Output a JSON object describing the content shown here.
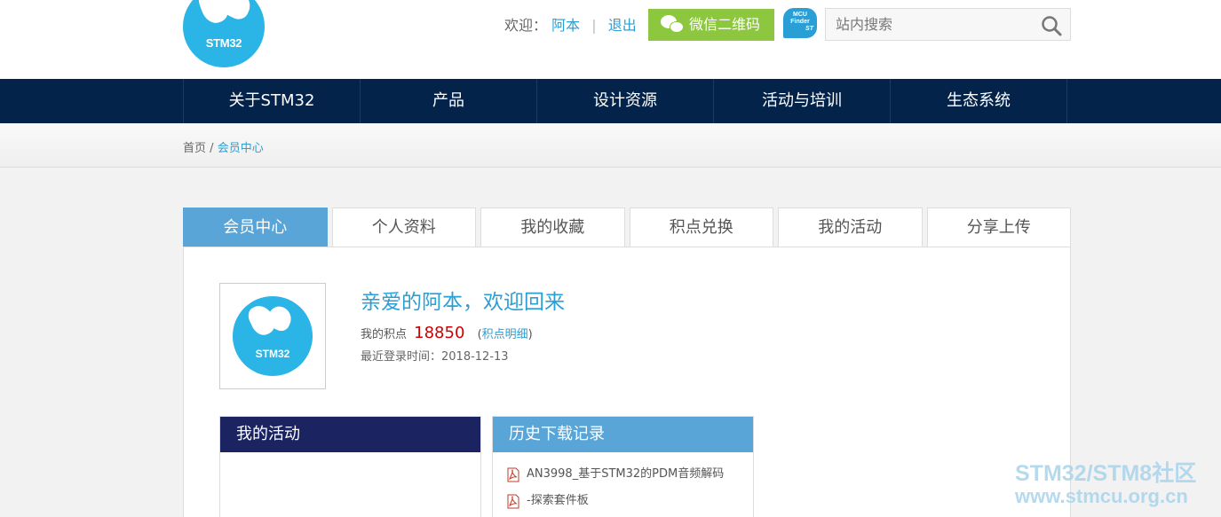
{
  "header": {
    "logo_text": "STM32",
    "welcome_label": "欢迎：",
    "username": "阿本",
    "separator": "|",
    "logout": "退出",
    "wechat_qr": "微信二维码",
    "mcu_finder_line1": "MCU",
    "mcu_finder_line2": "Finder",
    "mcu_finder_brand": "ST",
    "search_placeholder": "站内搜索"
  },
  "nav": {
    "items": [
      "关于STM32",
      "产品",
      "设计资源",
      "活动与培训",
      "生态系统"
    ]
  },
  "breadcrumb": {
    "home": "首页",
    "separator": "/",
    "current": "会员中心"
  },
  "tabs": [
    "会员中心",
    "个人资料",
    "我的收藏",
    "积点兑换",
    "我的活动",
    "分享上传"
  ],
  "profile": {
    "avatar_text": "STM32",
    "greeting": "亲爱的阿本，欢迎回来",
    "points_label": "我的积点",
    "points_value": "18850",
    "points_detail_open": "(",
    "points_detail_link": "积点明细",
    "points_detail_close": ")",
    "last_login": "最近登录时间：2018-12-13"
  },
  "my_activities": {
    "title": "我的活动"
  },
  "download_history": {
    "title": "历史下载记录",
    "items": [
      "AN3998_基于STM32的PDM音频解码",
      "-探索套件板"
    ]
  },
  "watermark": {
    "line1": "STM32/STM8社区",
    "line2": "www.stmcu.org.cn"
  },
  "colors": {
    "nav_bg": "#03234b",
    "accent_blue": "#2a9fd6",
    "active_tab": "#59a5d8",
    "wechat_green": "#8dc63f",
    "points_red": "#cc0000",
    "activity_header": "#1b2460"
  }
}
